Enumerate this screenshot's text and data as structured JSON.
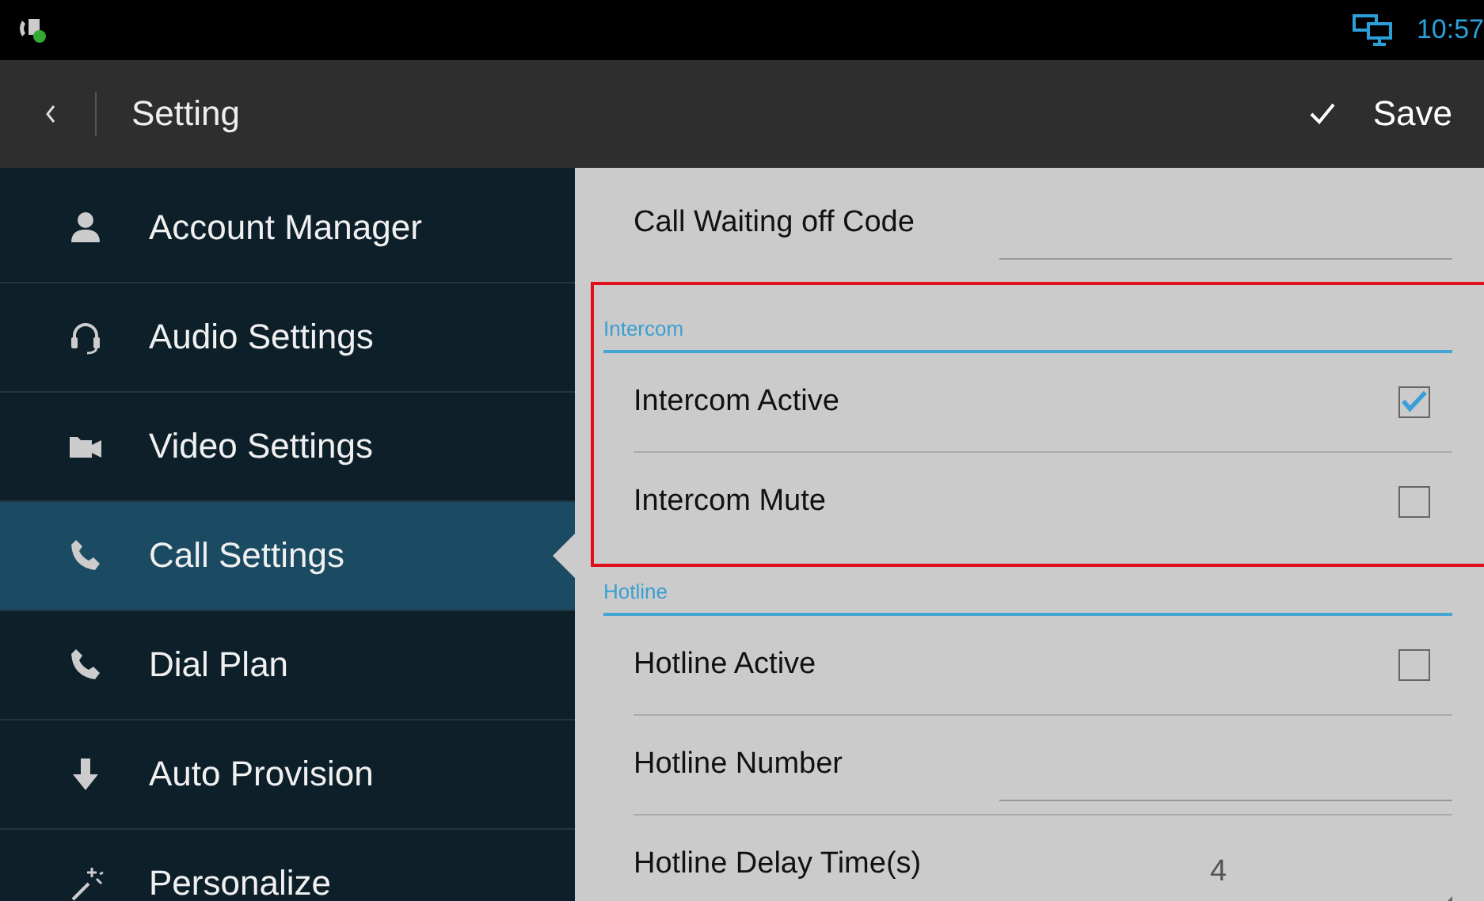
{
  "status_bar": {
    "time": "10:57"
  },
  "title_bar": {
    "title": "Setting",
    "action": "Save"
  },
  "sidebar": {
    "items": [
      {
        "label": "Account Manager",
        "selected": false
      },
      {
        "label": "Audio Settings",
        "selected": false
      },
      {
        "label": "Video Settings",
        "selected": false
      },
      {
        "label": "Call Settings",
        "selected": true
      },
      {
        "label": "Dial Plan",
        "selected": false
      },
      {
        "label": "Auto Provision",
        "selected": false
      },
      {
        "label": "Personalize",
        "selected": false
      }
    ]
  },
  "sections": [
    {
      "rows": [
        {
          "kind": "field",
          "label": "Call Waiting off Code"
        }
      ]
    },
    {
      "title": "Intercom",
      "highlighted": true,
      "rows": [
        {
          "kind": "checkbox",
          "label": "Intercom Active",
          "checked": true
        },
        {
          "kind": "checkbox",
          "label": "Intercom Mute",
          "checked": false
        }
      ]
    },
    {
      "title": "Hotline",
      "rows": [
        {
          "kind": "checkbox",
          "label": "Hotline Active",
          "checked": false
        },
        {
          "kind": "field",
          "label": "Hotline Number"
        },
        {
          "kind": "dropdown",
          "label": "Hotline Delay Time(s)",
          "value": "4"
        }
      ]
    }
  ]
}
